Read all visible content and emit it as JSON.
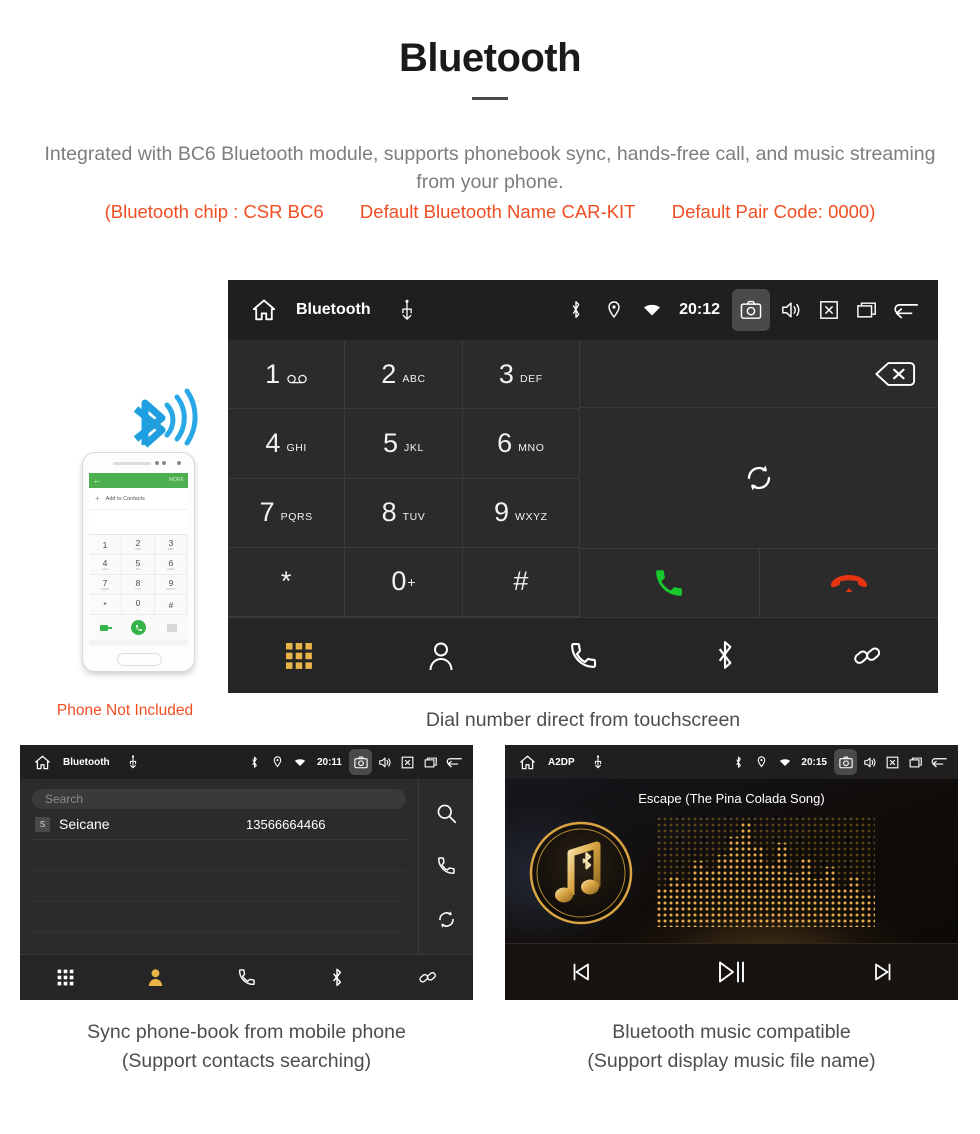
{
  "header": {
    "title": "Bluetooth",
    "intro": "Integrated with BC6 Bluetooth module, supports phonebook sync, hands-free call, and music streaming from your phone.",
    "spec_chip": "(Bluetooth chip : CSR BC6",
    "spec_name": "Default Bluetooth Name CAR-KIT",
    "spec_pair": "Default Pair Code: 0000)",
    "accent_color": "#F04E23",
    "muted_color": "#7d7d7d"
  },
  "dialer": {
    "statusbar": {
      "title": "Bluetooth",
      "time": "20:12",
      "icons_left": [
        "home-icon",
        "usb-icon"
      ],
      "icons_status": [
        "bluetooth-icon",
        "location-icon",
        "wifi-icon"
      ],
      "icons_right": [
        "camera-icon",
        "volume-icon",
        "close-box-icon",
        "recents-icon",
        "back-icon"
      ],
      "highlighted_icon": "camera-icon"
    },
    "keys": [
      {
        "num": "1",
        "sub": "",
        "voicemail": true
      },
      {
        "num": "2",
        "sub": "ABC",
        "voicemail": false
      },
      {
        "num": "3",
        "sub": "DEF",
        "voicemail": false
      },
      {
        "num": "4",
        "sub": "GHI",
        "voicemail": false
      },
      {
        "num": "5",
        "sub": "JKL",
        "voicemail": false
      },
      {
        "num": "6",
        "sub": "MNO",
        "voicemail": false
      },
      {
        "num": "7",
        "sub": "PQRS",
        "voicemail": false
      },
      {
        "num": "8",
        "sub": "TUV",
        "voicemail": false
      },
      {
        "num": "9",
        "sub": "WXYZ",
        "voicemail": false
      },
      {
        "num": "*",
        "sub": "",
        "voicemail": false
      },
      {
        "num": "0",
        "sup": "+",
        "sub": "",
        "voicemail": false
      },
      {
        "num": "#",
        "sub": "",
        "voicemail": false
      }
    ],
    "number_display": "",
    "right_icons": [
      "backspace-icon",
      "sync-icon"
    ],
    "call_button": "call-icon",
    "hangup_button": "hangup-icon",
    "navbar": [
      "keypad-icon",
      "contacts-icon",
      "calllog-icon",
      "bluetooth-icon",
      "link-icon"
    ],
    "navbar_active": "keypad-icon",
    "active_color": "#e8b44a"
  },
  "captions": {
    "dialer": "Dial number direct from touchscreen",
    "phonebook_line1": "Sync phone-book from mobile phone",
    "phonebook_line2": "(Support contacts searching)",
    "music_line1": "Bluetooth music compatible",
    "music_line2": "(Support display music file name)"
  },
  "phone_mockup": {
    "note": "Phone Not Included",
    "screen_action": "Add to Contacts",
    "screen_more": "MORE",
    "keys": [
      {
        "n": "1",
        "l": ""
      },
      {
        "n": "2",
        "l": "ABC"
      },
      {
        "n": "3",
        "l": "DEF"
      },
      {
        "n": "4",
        "l": "GHI"
      },
      {
        "n": "5",
        "l": "JKL"
      },
      {
        "n": "6",
        "l": "MNO"
      },
      {
        "n": "7",
        "l": "PQRS"
      },
      {
        "n": "8",
        "l": "TUV"
      },
      {
        "n": "9",
        "l": "WXYZ"
      },
      {
        "n": "*",
        "l": ""
      },
      {
        "n": "0",
        "l": "+"
      },
      {
        "n": "#",
        "l": ""
      }
    ]
  },
  "phonebook": {
    "statusbar": {
      "title": "Bluetooth",
      "time": "20:11",
      "highlighted_icon": "camera-icon"
    },
    "search_placeholder": "Search",
    "contacts": [
      {
        "badge": "S",
        "name": "Seicane",
        "number": "13566664466"
      }
    ],
    "rail_icons": [
      "search-icon",
      "call-icon",
      "sync-icon"
    ],
    "navbar": [
      "keypad-icon",
      "contacts-icon",
      "calllog-icon",
      "bluetooth-icon",
      "link-icon"
    ],
    "navbar_active": "contacts-icon"
  },
  "music": {
    "statusbar": {
      "title": "A2DP",
      "time": "20:15",
      "highlighted_icon": "camera-icon"
    },
    "song_title": "Escape (The Pina Colada Song)",
    "album_art": "music-note-bluetooth-icon",
    "controls": [
      "previous-icon",
      "play-pause-icon",
      "next-icon"
    ],
    "accent_color": "#d9a441"
  }
}
